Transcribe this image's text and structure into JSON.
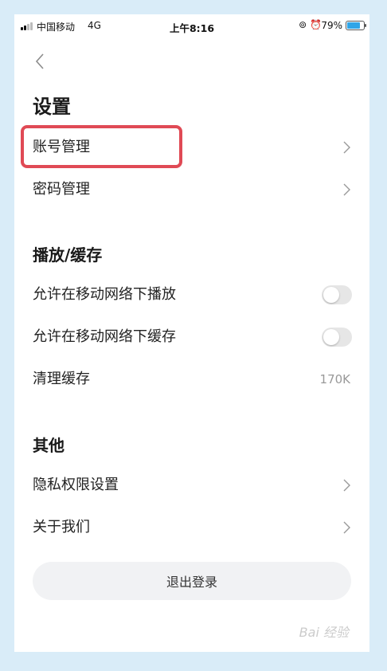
{
  "status_bar": {
    "carrier": "中国移动",
    "network": "4G",
    "time": "上午8:16",
    "battery": "79%",
    "icons": [
      "signal-icon",
      "lock-rotation-icon",
      "alarm-icon",
      "battery-icon"
    ]
  },
  "header": {
    "back_icon": "chevron-left-icon",
    "title": "设置"
  },
  "account_section": {
    "items": [
      {
        "label": "账号管理",
        "icon": "chevron-right-icon"
      },
      {
        "label": "密码管理",
        "icon": "chevron-right-icon"
      }
    ]
  },
  "playback_section": {
    "title": "播放/缓存",
    "items": [
      {
        "label": "允许在移动网络下播放",
        "toggle": "off"
      },
      {
        "label": "允许在移动网络下缓存",
        "toggle": "off"
      },
      {
        "label": "清理缓存",
        "value": "170K"
      }
    ]
  },
  "other_section": {
    "title": "其他",
    "items": [
      {
        "label": "隐私权限设置",
        "icon": "chevron-right-icon"
      },
      {
        "label": "关于我们",
        "icon": "chevron-right-icon"
      }
    ]
  },
  "logout_label": "退出登录",
  "watermark": "Bai 经验",
  "colors": {
    "highlight": "#e04a55",
    "battery": "#30a5e8",
    "background": "#d9ecf8"
  }
}
